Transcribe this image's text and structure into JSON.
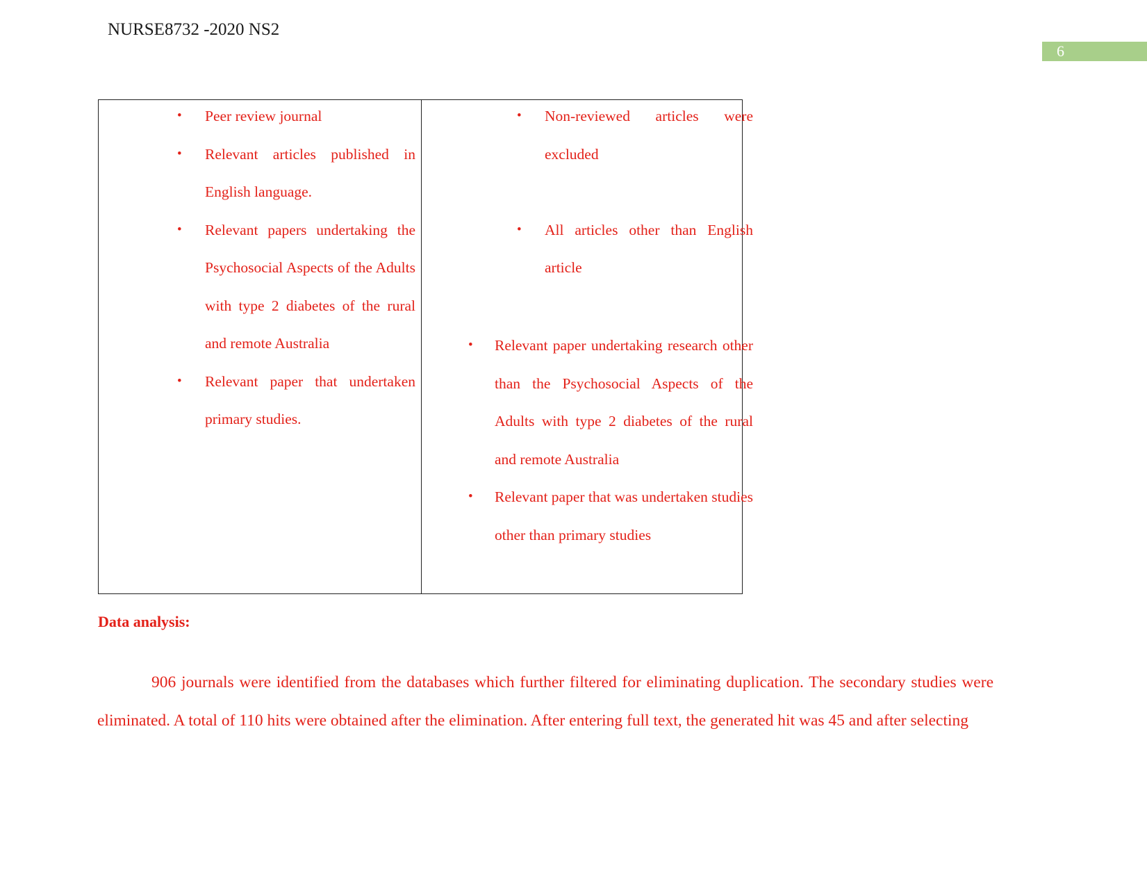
{
  "header": {
    "course_code_line": "NURSE8732 -2020 NS2"
  },
  "page_badge": {
    "number": "6",
    "background_color": "#a8cf8a",
    "text_color": "#ffffff"
  },
  "colors": {
    "body_red": "#e32119",
    "header_black": "#1a1a1a",
    "table_border": "#202020",
    "badge_green": "#a8cf8a"
  },
  "criteria_table": {
    "inclusion_column": {
      "bullets": [
        "Peer review journal",
        "Relevant articles published in English language.",
        "Relevant papers undertaking the  Psychosocial Aspects of the Adults with type 2 diabetes of the   rural and remote Australia",
        "Relevant paper that undertaken primary studies."
      ]
    },
    "exclusion_column": {
      "bullets_top": [
        "Non-reviewed articles were excluded",
        "All articles other than English article"
      ],
      "bullets_bottom": [
        "Relevant paper  undertaking research other than the  Psychosocial Aspects of the Adults with type 2 diabetes of the  rural and remote Australia",
        "Relevant paper that was undertaken studies other than primary studies"
      ]
    }
  },
  "data_analysis": {
    "heading": "Data analysis:",
    "paragraph": "906 journals were identified from the databases which further filtered for eliminating duplication. The secondary studies were eliminated.  A total of 110 hits were obtained after the elimination. After entering full text, the generated hit was 45 and after selecting"
  }
}
